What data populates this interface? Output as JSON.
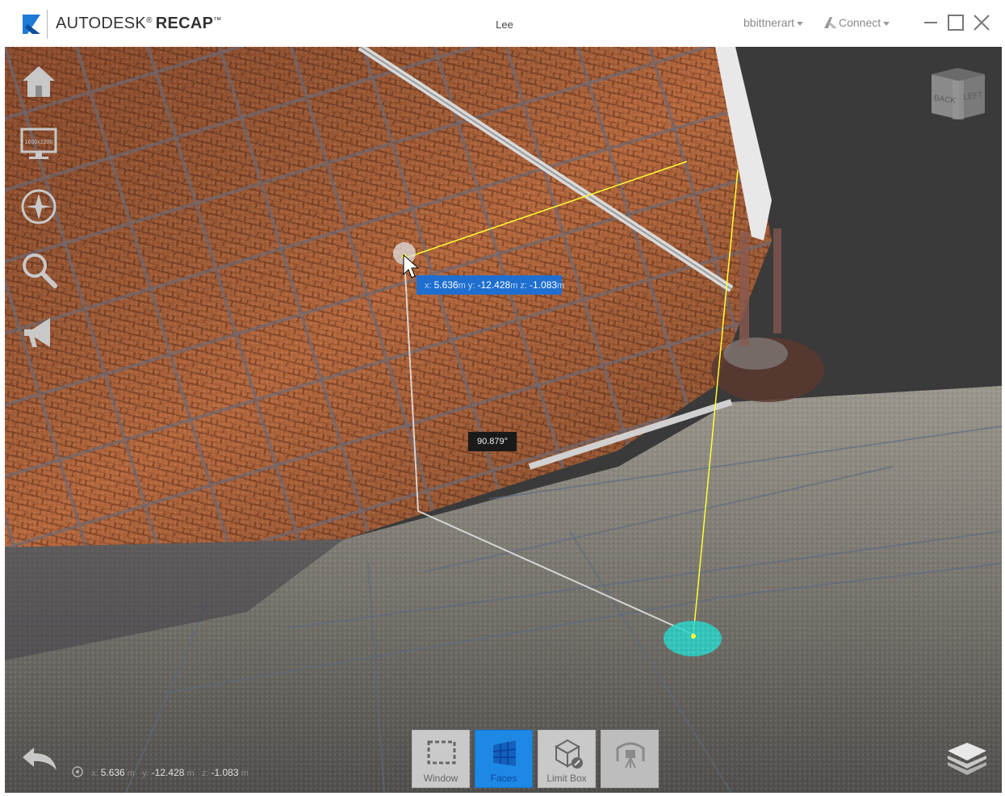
{
  "window": {
    "brand": "AUTODESK",
    "brand_reg": "®",
    "product": "RECAP",
    "product_tm": "™",
    "doc_title": "Lee",
    "user_name": "bbittnerart",
    "connect_label": "Connect"
  },
  "side_tools": [
    {
      "name": "home-icon"
    },
    {
      "name": "display-icon",
      "label": "1600x1200"
    },
    {
      "name": "compass-icon"
    },
    {
      "name": "magnifier-icon"
    },
    {
      "name": "megaphone-icon"
    }
  ],
  "viewcube": {
    "left_face": "BACK",
    "right_face": "LEFT"
  },
  "measurement": {
    "x_label": "x:",
    "x_value": "5.636",
    "y_label": "m  y:",
    "y_value": "-12.428",
    "z_label": "m  z:",
    "z_value": "-1.083",
    "unit": "m",
    "angle": "90.879°"
  },
  "toolbar": {
    "buttons": [
      {
        "label": "Window",
        "state": "normal"
      },
      {
        "label": "Faces",
        "state": "active"
      },
      {
        "label": "Limit Box",
        "state": "normal"
      },
      {
        "label": "",
        "state": "disabled"
      }
    ]
  },
  "status": {
    "x_label": "x:",
    "x_value": "5.636",
    "x_unit": "m",
    "y_label": "y:",
    "y_value": "-12.428",
    "y_unit": "m",
    "z_label": "z:",
    "z_value": "-1.083",
    "z_unit": "m"
  },
  "colors": {
    "accent_blue": "#1e88e5",
    "measure_yellow": "#ffff33",
    "brick": "#b9673b",
    "ground": "#7a7770",
    "sky": "#3a3a3a"
  }
}
